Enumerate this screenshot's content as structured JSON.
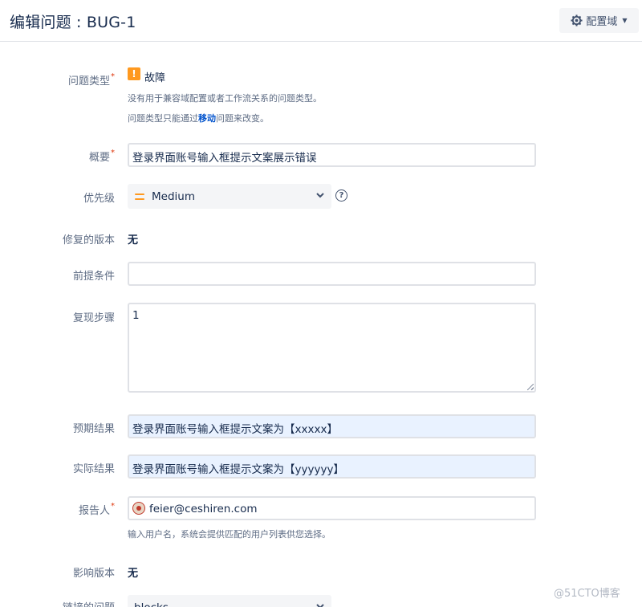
{
  "header": {
    "title": "编辑问题 : BUG-1",
    "config_button": "配置域"
  },
  "fields": {
    "issue_type": {
      "label": "问题类型",
      "value": "故障",
      "icon": "bug-warning-icon",
      "hint1": "没有用于兼容域配置或者工作流关系的问题类型。",
      "hint2_prefix": "问题类型只能通过",
      "hint2_link": "移动",
      "hint2_suffix": "问题来改变。"
    },
    "summary": {
      "label": "概要",
      "value": "登录界面账号输入框提示文案展示错误"
    },
    "priority": {
      "label": "优先级",
      "value": "Medium",
      "icon": "medium-priority-icon"
    },
    "fix_version": {
      "label": "修复的版本",
      "value": "无"
    },
    "precondition": {
      "label": "前提条件",
      "value": ""
    },
    "steps": {
      "label": "复现步骤",
      "value": "1"
    },
    "expected": {
      "label": "预期结果",
      "value": "登录界面账号输入框提示文案为【xxxxx】"
    },
    "actual": {
      "label": "实际结果",
      "value": "登录界面账号输入框提示文案为【yyyyyy】"
    },
    "reporter": {
      "label": "报告人",
      "value": "feier@ceshiren.com",
      "hint": "输入用户名，系统会提供匹配的用户列表供您选择。"
    },
    "affects_version": {
      "label": "影响版本",
      "value": "无"
    },
    "linked_issues": {
      "label": "链接的问题",
      "value": "blocks"
    }
  },
  "watermark": "@51CTO博客",
  "colors": {
    "accent": "#ff991f",
    "link": "#0052cc",
    "required": "#de350b"
  }
}
